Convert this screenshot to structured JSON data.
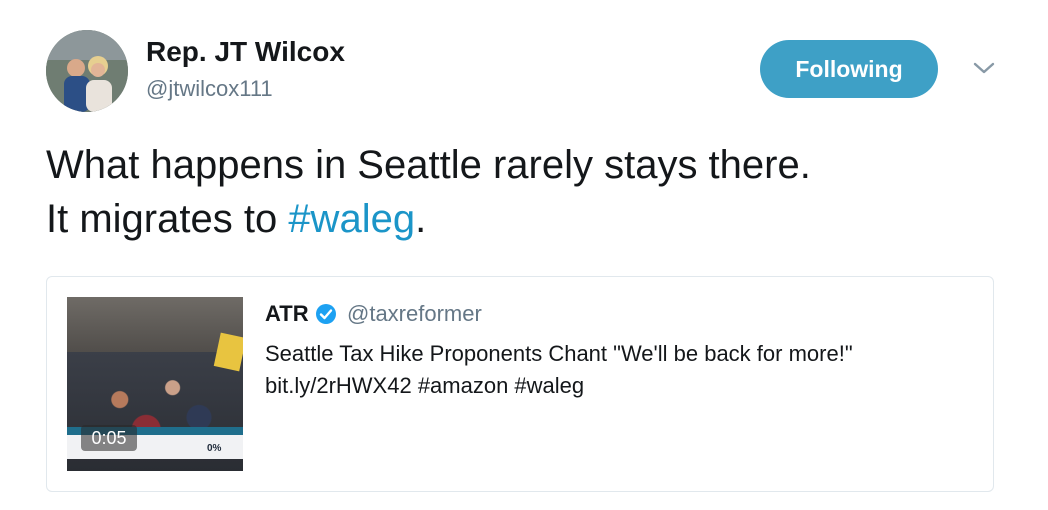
{
  "author": {
    "name": "Rep. JT Wilcox",
    "handle": "@jtwilcox111",
    "avatar_icon": "profile-photo"
  },
  "follow_button": {
    "label": "Following"
  },
  "menu_icon": "chevron-down-icon",
  "tweet": {
    "line1": "What happens in Seattle rarely stays there.",
    "line2_prefix": "It migrates to ",
    "hashtag": "#waleg",
    "line2_suffix": "."
  },
  "quoted_tweet": {
    "author_name": "ATR",
    "verified": true,
    "author_handle": "@taxreformer",
    "text": "Seattle Tax Hike Proponents Chant \"We'll be back for more!\"",
    "link_line": "bit.ly/2rHWX42 #amazon #waleg",
    "video": {
      "duration": "0:05",
      "overlay_percent": "0%"
    }
  },
  "colors": {
    "accent": "#1b95c8",
    "button_bg": "#3ea0c6",
    "secondary_text": "#657786",
    "border": "#e1e8ed"
  }
}
